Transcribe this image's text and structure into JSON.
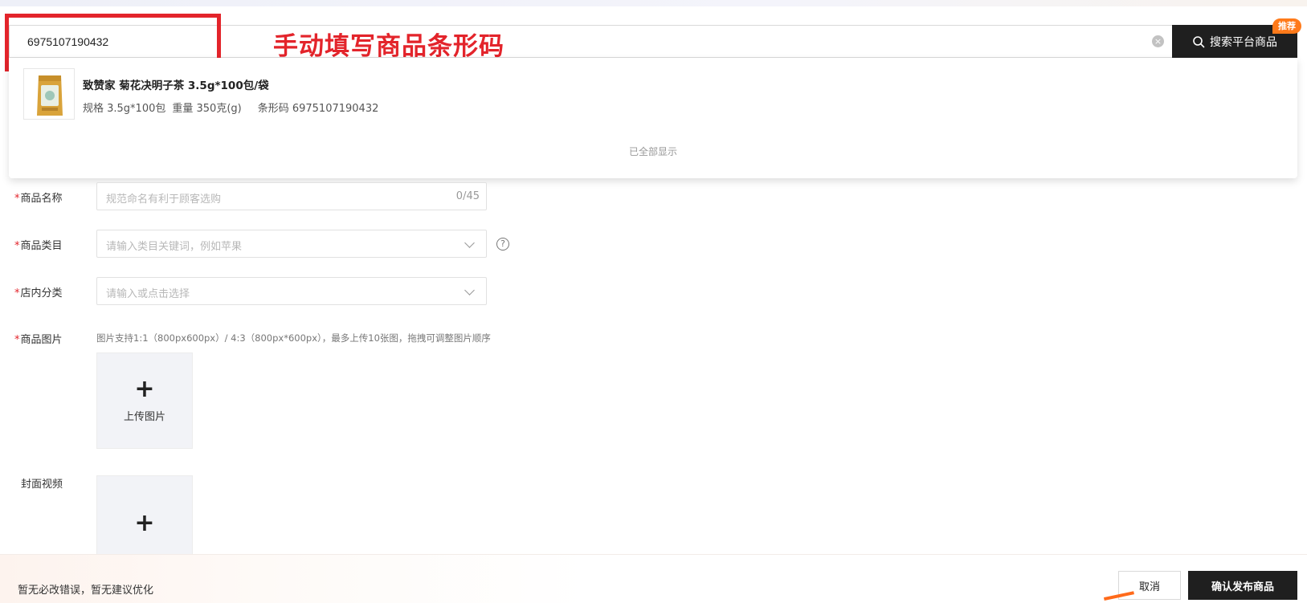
{
  "search": {
    "value": "6975107190432",
    "clear_icon": "×",
    "button_label": "搜索平台商品",
    "badge": "推荐"
  },
  "annotation": {
    "text": "手动填写商品条形码",
    "color": "#e3242b"
  },
  "dropdown": {
    "result": {
      "title": "致赞家 菊花决明子茶 3.5g*100包/袋",
      "spec": "规格 3.5g*100包",
      "weight": "重量 350克(g)",
      "barcode": "条形码 6975107190432"
    },
    "end_text": "已全部显示"
  },
  "form": {
    "name": {
      "required": "*",
      "label": "商品名称",
      "placeholder": "规范命名有利于顾客选购",
      "counter": "0/45"
    },
    "category": {
      "required": "*",
      "label": "商品类目",
      "placeholder": "请输入类目关键词，例如苹果",
      "help": "?"
    },
    "store_category": {
      "required": "*",
      "label": "店内分类",
      "placeholder": "请输入或点击选择"
    },
    "images": {
      "required": "*",
      "label": "商品图片",
      "hint": "图片支持1:1（800px600px）/ 4:3（800px*600px），最多上传10张图，拖拽可调整图片顺序",
      "plus": "+",
      "upload_label": "上传图片"
    },
    "video": {
      "label": "封面视频",
      "plus": "+"
    }
  },
  "footer": {
    "message": "暂无必改错误，暂无建议优化",
    "cancel_label": "取消",
    "publish_label": "确认发布商品"
  },
  "colors": {
    "primary_dark": "#1f1f1f",
    "accent_orange": "#ff7a1a",
    "required_red": "#e3242b"
  }
}
